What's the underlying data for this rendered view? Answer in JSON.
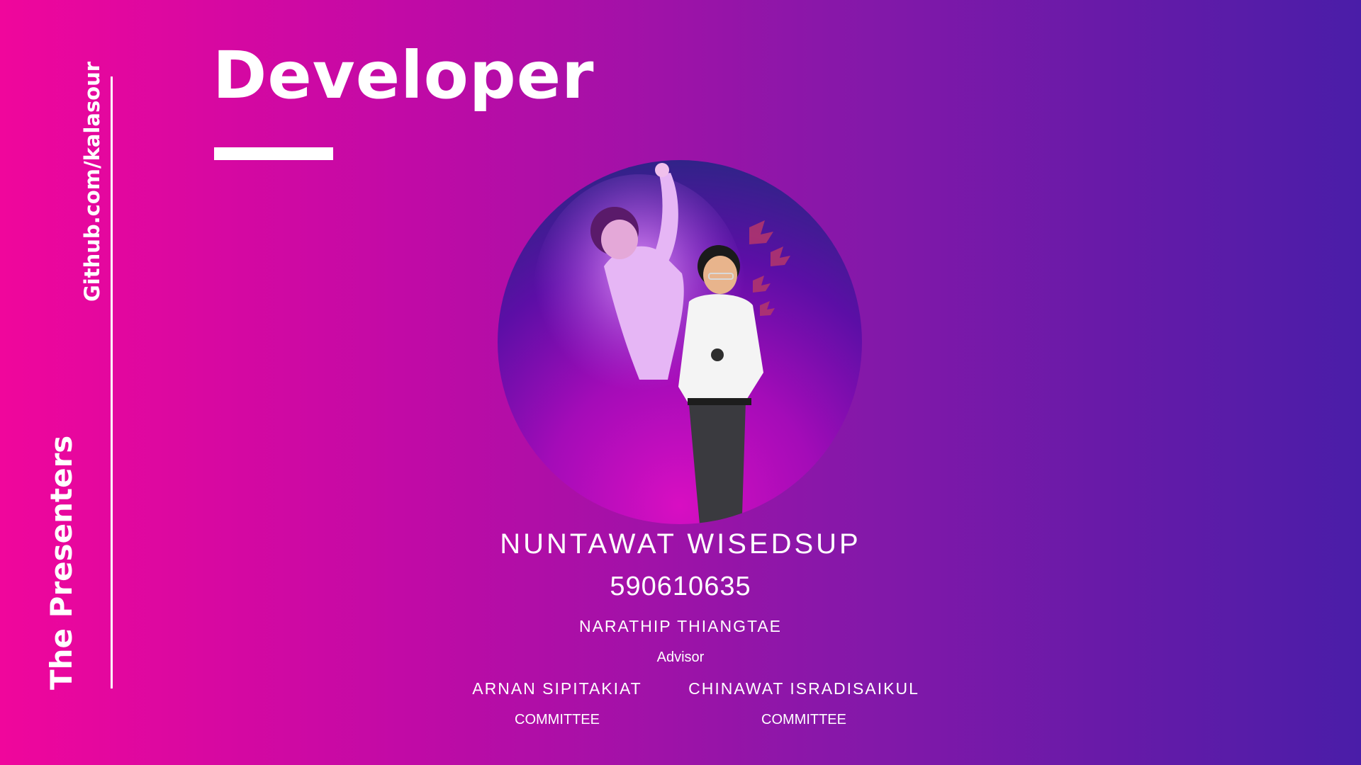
{
  "slide": {
    "title": "Developer",
    "side_link": "Github.com/kalasour",
    "side_label": "The Presenters"
  },
  "developer": {
    "name": "NUNTAWAT  WISEDSUP",
    "student_id": "590610635"
  },
  "advisor": {
    "name": "NARATHIP THIANGTAE",
    "role": "Advisor"
  },
  "committee": [
    {
      "name": "ARNAN SIPITAKIAT",
      "role": "COMMITTEE"
    },
    {
      "name": "CHINAWAT ISRADISAIKUL",
      "role": "COMMITTEE"
    }
  ],
  "colors": {
    "gradient_left": "#f0069c",
    "gradient_right": "#4a1da8",
    "text": "#ffffff"
  }
}
